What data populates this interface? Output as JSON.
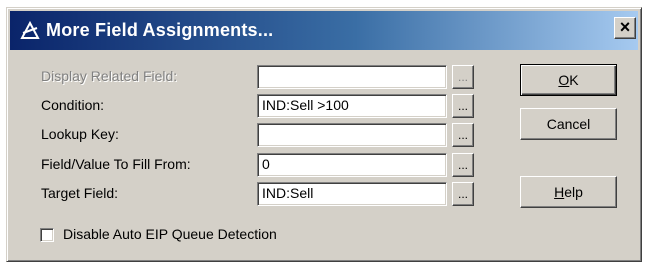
{
  "dialog": {
    "title": "More Field Assignments...",
    "close_glyph": "×"
  },
  "fields": [
    {
      "label": "Display Related Field:",
      "value": "",
      "browse_glyph": "...",
      "enabled": false
    },
    {
      "label": "Condition:",
      "value": "IND:Sell >100",
      "browse_glyph": "...",
      "enabled": true
    },
    {
      "label": "Lookup Key:",
      "value": "",
      "browse_glyph": "...",
      "enabled": true
    },
    {
      "label": "Field/Value To Fill From:",
      "value": "0",
      "browse_glyph": "...",
      "enabled": true
    },
    {
      "label": "Target Field:",
      "value": "IND:Sell",
      "browse_glyph": "...",
      "enabled": true
    }
  ],
  "buttons": {
    "ok": {
      "mnemonic": "O",
      "rest": "K"
    },
    "cancel": {
      "label": "Cancel"
    },
    "help": {
      "mnemonic": "H",
      "rest": "elp"
    }
  },
  "checkbox": {
    "label": "Disable Auto EIP Queue Detection",
    "checked": false
  },
  "icons": {
    "app": "app-logo-icon",
    "close": "close-icon"
  },
  "colors": {
    "title_start": "#0a246a",
    "title_end": "#a6caf0",
    "face": "#d4d0c8",
    "disabled_text": "#808080"
  }
}
